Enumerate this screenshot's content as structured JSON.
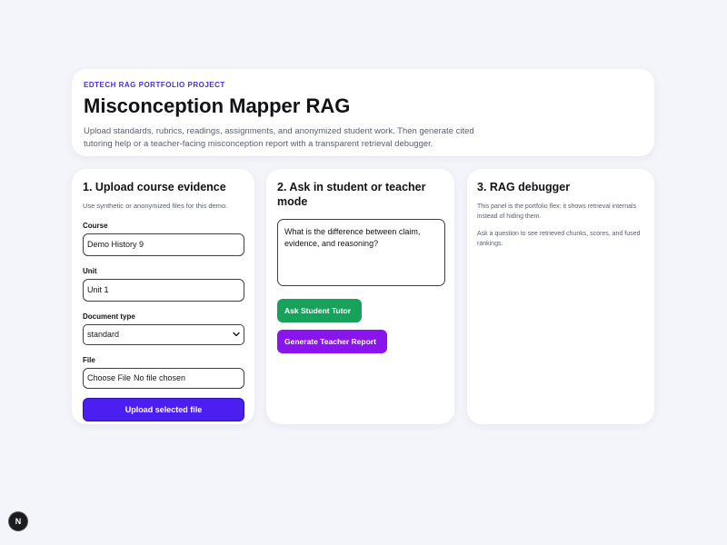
{
  "header": {
    "eyebrow": "EDTECH RAG PORTFOLIO PROJECT",
    "title": "Misconception Mapper RAG",
    "subtitle": "Upload standards, rubrics, readings, assignments, and anonymized student work. Then generate cited tutoring help or a teacher-facing misconception report with a transparent retrieval debugger."
  },
  "upload": {
    "title": "1. Upload course evidence",
    "note": "Use synthetic or anonymized files for this demo.",
    "course_label": "Course",
    "course_value": "Demo History 9",
    "unit_label": "Unit",
    "unit_value": "Unit 1",
    "doctype_label": "Document type",
    "doctype_value": "standard",
    "file_label": "File",
    "file_button": "Choose File",
    "file_status": "No file chosen",
    "upload_button": "Upload selected file"
  },
  "ask": {
    "title": "2. Ask in student or teacher mode",
    "question_value": "What is the difference between claim, evidence, and reasoning?",
    "tutor_button": "Ask Student Tutor",
    "report_button": "Generate Teacher Report"
  },
  "debugger": {
    "title": "3. RAG debugger",
    "text1": "This panel is the portfolio flex: it shows retrieval internals instead of hiding them.",
    "text2": "Ask a question to see retrieved chunks, scores, and fused rankings."
  },
  "badge": {
    "letter": "N"
  },
  "icons": {
    "select_chevron": "chevron-down-icon"
  },
  "colors": {
    "accent": "#4a1fef",
    "tutor": "#16a25a",
    "report": "#8a14ee",
    "eyebrow": "#4a2fd8"
  }
}
